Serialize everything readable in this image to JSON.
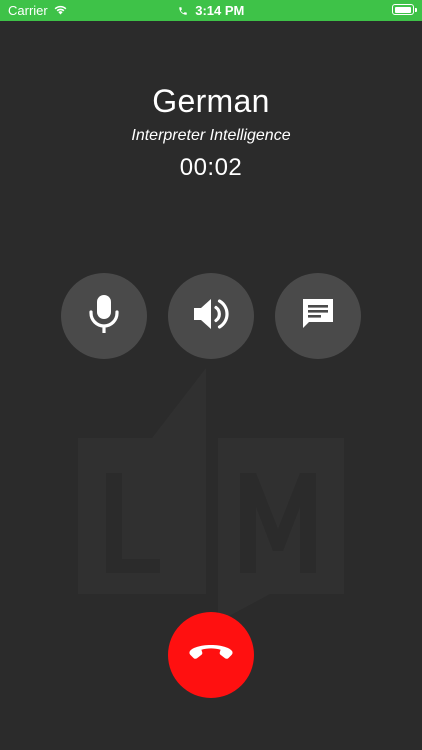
{
  "status_bar": {
    "carrier": "Carrier",
    "time": "3:14 PM",
    "battery_level": 1.0,
    "color": "#3ec248"
  },
  "call": {
    "language": "German",
    "provider": "Interpreter Intelligence",
    "duration": "00:02"
  },
  "controls": {
    "mute_icon": "microphone-icon",
    "speaker_icon": "speaker-icon",
    "chat_icon": "chat-message-icon"
  },
  "end_call": {
    "icon": "phone-hangup-icon",
    "color": "#ff1010"
  },
  "watermark": {
    "letters": "LM",
    "icon": "lm-logo-watermark"
  }
}
